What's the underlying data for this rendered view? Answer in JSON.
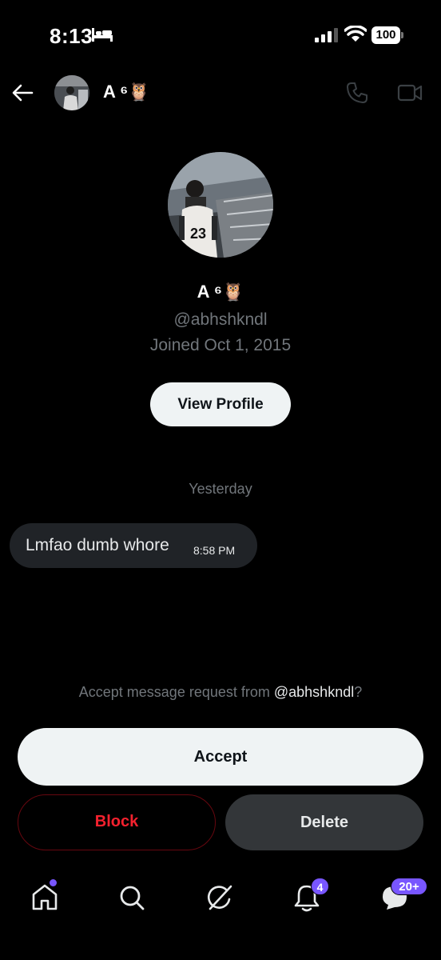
{
  "status_bar": {
    "time": "8:13",
    "battery": "100"
  },
  "header": {
    "name": "A ⁶🦉"
  },
  "profile": {
    "name": "A ⁶🦉",
    "handle": "@abhshkndl",
    "joined": "Joined Oct 1, 2015",
    "view_profile_label": "View Profile",
    "jersey_number": "23"
  },
  "conversation": {
    "date_separator": "Yesterday",
    "messages": [
      {
        "text": "Lmfao dumb whore",
        "time": "8:58 PM"
      }
    ]
  },
  "request": {
    "prefix": "Accept message request from ",
    "handle": "@abhshkndl",
    "suffix": "?",
    "accept_label": "Accept",
    "block_label": "Block",
    "delete_label": "Delete"
  },
  "nav": {
    "notifications_badge": "4",
    "messages_badge": "20+"
  },
  "colors": {
    "background": "#000000",
    "accent": "#7856ff",
    "danger": "#f4212e",
    "muted_text": "#71767b"
  }
}
